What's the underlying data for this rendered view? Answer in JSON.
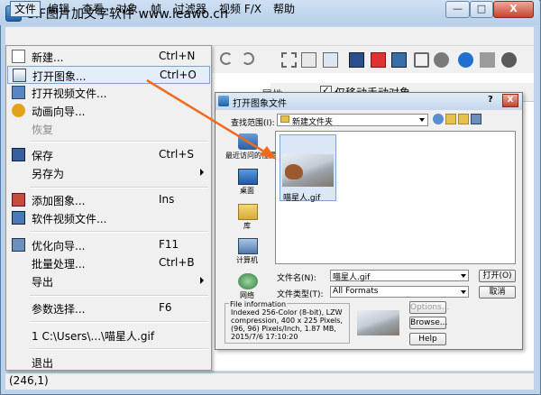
{
  "window": {
    "title": "GIF图片加文字软件 www.leawo.cn",
    "minimize_glyph": "—",
    "maximize_glyph": "□",
    "close_glyph": "X"
  },
  "menubar": {
    "items": [
      "文件",
      "编辑",
      "查看",
      "对象",
      "帧",
      "过滤器",
      "视频 F/X",
      "帮助"
    ]
  },
  "file_menu": {
    "items": [
      {
        "label": "新建...",
        "shortcut": "Ctrl+N",
        "icon": "new-file-icon"
      },
      {
        "label": "打开图象...",
        "shortcut": "Ctrl+O",
        "icon": "open-image-icon",
        "highlighted": true
      },
      {
        "label": "打开视频文件...",
        "shortcut": "",
        "icon": "open-video-icon"
      },
      {
        "label": "动画向导...",
        "shortcut": "",
        "icon": "animation-wizard-icon"
      },
      {
        "label": "恢复",
        "shortcut": "",
        "icon": "",
        "disabled": true
      },
      {
        "label": "保存",
        "shortcut": "Ctrl+S",
        "icon": "save-icon"
      },
      {
        "label": "另存为",
        "shortcut": "",
        "icon": "",
        "submenu": true
      },
      {
        "label": "添加图象...",
        "shortcut": "Ins",
        "icon": "add-image-icon"
      },
      {
        "label": "软件视频文件...",
        "shortcut": "",
        "icon": "video-file-icon"
      },
      {
        "label": "优化向导...",
        "shortcut": "F11",
        "icon": "optimize-wizard-icon"
      },
      {
        "label": "批量处理...",
        "shortcut": "Ctrl+B",
        "icon": ""
      },
      {
        "label": "导出",
        "shortcut": "",
        "icon": "",
        "submenu": true
      },
      {
        "label": "参数选择...",
        "shortcut": "F6",
        "icon": ""
      },
      {
        "label": "1  C:\\Users\\...\\喵星人.gif",
        "shortcut": "",
        "icon": ""
      },
      {
        "label": "退出",
        "shortcut": "",
        "icon": ""
      }
    ]
  },
  "panel": {
    "tab_label": "属性",
    "checkbox_label": "仅移动手动对象",
    "checkbox_mark": "✓"
  },
  "status": {
    "coords": "(246,1)"
  },
  "dialog": {
    "title": "打开图象文件",
    "help_glyph": "?",
    "close_glyph": "X",
    "look_in_label": "查找范围(I):",
    "look_in_value": "新建文件夹",
    "places": [
      {
        "label": "最近访问的位置",
        "icon": "recent-places-icon"
      },
      {
        "label": "桌面",
        "icon": "desktop-icon"
      },
      {
        "label": "库",
        "icon": "library-icon"
      },
      {
        "label": "计算机",
        "icon": "computer-icon"
      },
      {
        "label": "网络",
        "icon": "network-icon"
      }
    ],
    "file_item": {
      "name": "喵星人.gif"
    },
    "file_name_label": "文件名(N):",
    "file_name_value": "喵星人.gif",
    "file_type_label": "文件类型(T):",
    "file_type_value": "All Formats",
    "open_button": "打开(O)",
    "cancel_button": "取消",
    "info_title": "File information",
    "info_text": "Indexed 256-Color (8-bit), LZW compression, 400 x 225 Pixels, (96, 96) Pixels/Inch,  1.87 MB,  2015/7/6 17:10:20",
    "options_button": "Options...",
    "browse_button": "Browse...",
    "help_button": "Help"
  },
  "colors": {
    "accent": "#f26b1d",
    "highlight": "#e4eefa"
  }
}
